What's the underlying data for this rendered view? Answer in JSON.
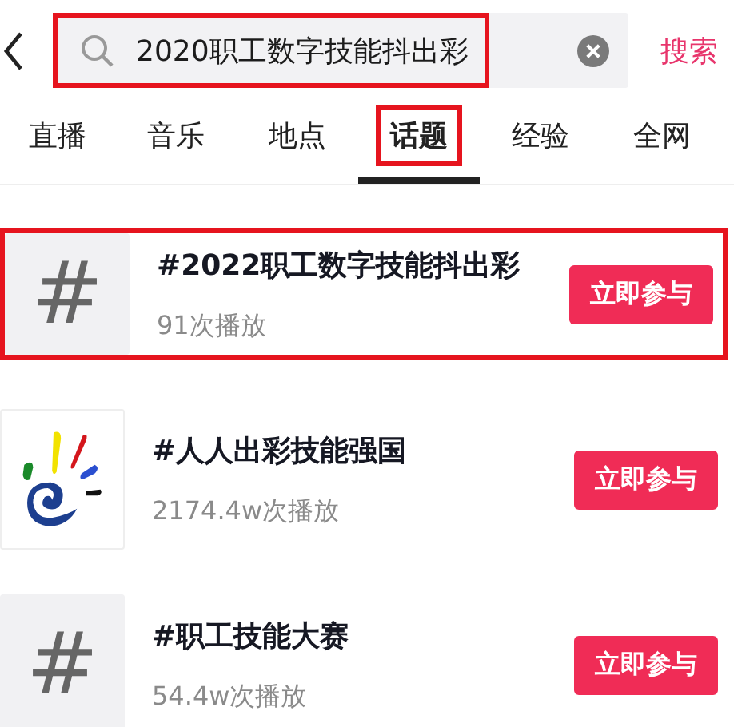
{
  "search": {
    "value": "2020职工数字技能抖出彩",
    "highlighted": true,
    "button": "搜索"
  },
  "tabs": [
    {
      "label": "直播",
      "selected": false,
      "highlighted": false
    },
    {
      "label": "音乐",
      "selected": false,
      "highlighted": false
    },
    {
      "label": "地点",
      "selected": false,
      "highlighted": false
    },
    {
      "label": "话题",
      "selected": true,
      "highlighted": true
    },
    {
      "label": "经验",
      "selected": false,
      "highlighted": false
    },
    {
      "label": "全网",
      "selected": false,
      "highlighted": false
    }
  ],
  "topics": [
    {
      "kind": "hash",
      "symbol": "#",
      "title": "#2022职工数字技能抖出彩",
      "plays": "91次播放",
      "button": "立即参与",
      "highlighted": true
    },
    {
      "kind": "logo",
      "title": "#人人出彩技能强国",
      "plays": "2174.4w次播放",
      "button": "立即参与",
      "highlighted": false
    },
    {
      "kind": "hash",
      "symbol": "#",
      "title": "#职工技能大赛",
      "plays": "54.4w次播放",
      "button": "立即参与",
      "highlighted": false
    }
  ]
}
